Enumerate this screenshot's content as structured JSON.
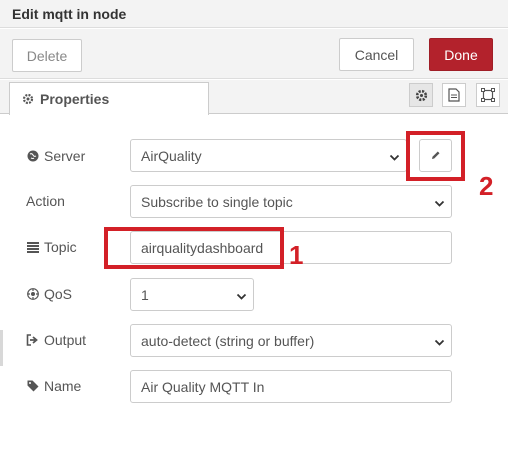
{
  "dialog": {
    "title": "Edit mqtt in node"
  },
  "toolbar": {
    "delete_label": "Delete",
    "cancel_label": "Cancel",
    "done_label": "Done"
  },
  "tabs": {
    "properties_label": "Properties"
  },
  "form": {
    "server": {
      "label": "Server",
      "value": "AirQuality"
    },
    "action": {
      "label": "Action",
      "value": "Subscribe to single topic"
    },
    "topic": {
      "label": "Topic",
      "value": "airqualitydashboard"
    },
    "qos": {
      "label": "QoS",
      "value": "1"
    },
    "output": {
      "label": "Output",
      "value": "auto-detect (string or buffer)"
    },
    "name": {
      "label": "Name",
      "value": "Air Quality MQTT In"
    }
  },
  "annotations": {
    "topic_number": "1",
    "edit_number": "2"
  },
  "colors": {
    "done_button": "#b3222c",
    "annotation": "#d32027",
    "border": "#cccccc"
  },
  "icons": [
    "gear-icon",
    "document-icon",
    "frame-icon",
    "globe-icon",
    "list-icon",
    "qos-icon",
    "sign-out-icon",
    "tag-icon",
    "pencil-icon",
    "chevron-down-icon"
  ]
}
